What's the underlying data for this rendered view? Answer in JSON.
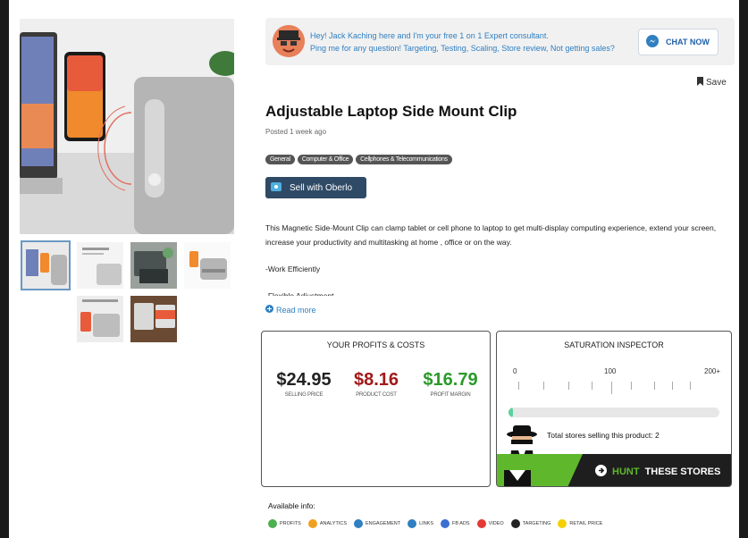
{
  "banner": {
    "line1": "Hey! Jack Kaching here and I'm your free 1 on 1 Expert consultant.",
    "line2": "Ping me for any question! Targeting, Testing, Scaling, Store review, Not getting sales?",
    "chat_label": "CHAT NOW"
  },
  "save_label": "Save",
  "product": {
    "title": "Adjustable Laptop Side Mount Clip",
    "posted": "Posted 1 week ago",
    "tags": [
      "General",
      "Computer & Office",
      "Cellphones & Telecommunications"
    ],
    "oberlo_label": "Sell with Oberlo",
    "description": [
      "This Magnetic Side-Mount Clip can clamp tablet or cell phone to laptop to get multi-display computing experience, extend your screen, increase your productivity and multitasking at home , office or on the way.",
      "-Work Efficiently",
      "-Flexible Adjustment"
    ],
    "read_more": "Read more"
  },
  "profits": {
    "title": "YOUR PROFITS & COSTS",
    "selling_price": "$24.95",
    "selling_label": "SELLING PRICE",
    "product_cost": "$8.16",
    "cost_label": "PRODUCT COST",
    "profit_margin": "$16.79",
    "margin_label": "PROFIT MARGIN",
    "colors": {
      "price": "#222222",
      "cost": "#a31919",
      "margin": "#2a9a2a"
    }
  },
  "saturation": {
    "title": "SATURATION INSPECTOR",
    "scale": [
      "0",
      "100",
      "200+"
    ],
    "level_fraction": 0.01,
    "total_text": "Total stores selling this product: 2",
    "hunt_word1": "HUNT",
    "hunt_word2": "THESE STORES"
  },
  "available": {
    "title": "Available info:",
    "items": [
      {
        "label": "PROFITS",
        "icon": "dollar-icon",
        "color": "#4caf50"
      },
      {
        "label": "ANALYTICS",
        "icon": "analytics-icon",
        "color": "#f0a020"
      },
      {
        "label": "ENGAGEMENT",
        "icon": "engagement-icon",
        "color": "#2f7fc1"
      },
      {
        "label": "LINKS",
        "icon": "link-icon",
        "color": "#2f7fc1"
      },
      {
        "label": "FB ADS",
        "icon": "fb-ads-icon",
        "color": "#3b6fd0"
      },
      {
        "label": "VIDEO",
        "icon": "video-icon",
        "color": "#e53935"
      },
      {
        "label": "TARGETING",
        "icon": "target-icon",
        "color": "#222222"
      },
      {
        "label": "RETAIL PRICE",
        "icon": "retail-price-icon",
        "color": "#f5d000"
      }
    ]
  }
}
